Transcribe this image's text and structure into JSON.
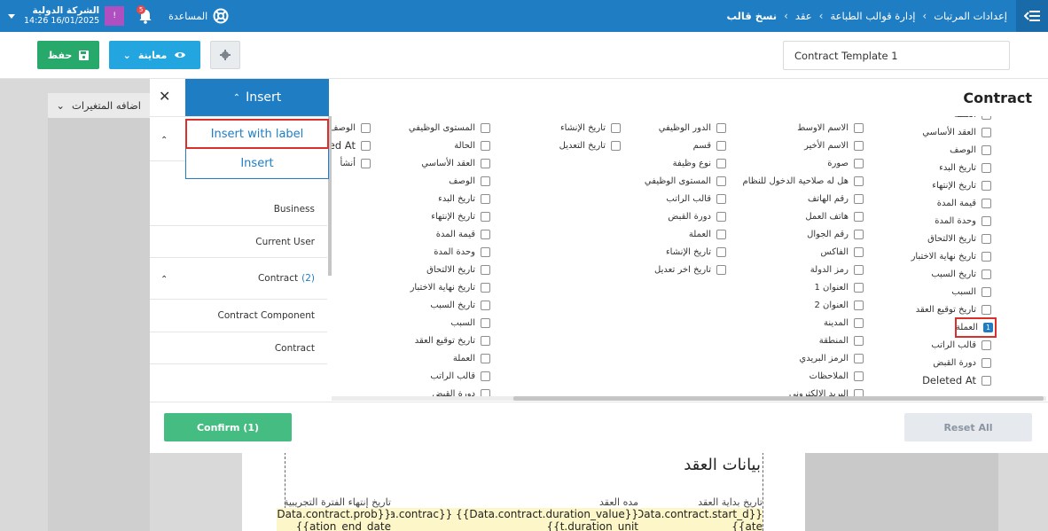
{
  "topbar": {
    "breadcrumbs": [
      "إعدادات المرتبات",
      "إدارة قوالب الطباعة",
      "عقد",
      "نسخ قالب"
    ],
    "help_label": "المساعدة",
    "notification_count": "5",
    "company_name": "الشركة الدولية",
    "datetime": "14:26 16/01/2025",
    "avatar_text": "!"
  },
  "toolbar": {
    "save_label": "حفظ",
    "preview_label": "معاينة",
    "template_name": "Contract Template 1"
  },
  "background": {
    "variables_label": "اضافه المتغيرات",
    "doc_heading": "بيانات العقد",
    "columns": [
      {
        "label": "تاريخ بداية العقد",
        "value": "Data.contract.start_d}}",
        "value2": "{{ate"
      },
      {
        "label": "مده العقد",
        "value": "Data.contrac}} {{Data.contract.duration_value}}",
        "value2": "{{t.duration_unit"
      },
      {
        "label": "تاريخ إنتهاء الفترة التجريبية",
        "value": "Data.contract.prob}}",
        "value2": "{{ation_end_date"
      }
    ]
  },
  "modal": {
    "title": "Contract",
    "insert_tab_label": "Insert",
    "dropdown": {
      "insert_with_label": "Insert with label",
      "insert": "Insert"
    },
    "left_list": {
      "business": "Business",
      "current_user": "Current User",
      "contract": "Contract",
      "contract_count": "(2)",
      "contract_component": "Contract Component",
      "contract_item": "Contract"
    },
    "col1": [
      "العملة",
      "العقد الأساسي",
      "الوصف",
      "تاريخ البدء",
      "تاريخ الإنتهاء",
      "قيمة المدة",
      "وحدة المدة",
      "تاريخ الالتحاق",
      "تاريخ نهاية الاختبار",
      "تاريخ السبب",
      "السبب",
      "تاريخ توقيع العقد",
      "العملة",
      "قالب الراتب",
      "دورة القبض",
      "Deleted At"
    ],
    "col2": [
      "الاسم الاوسط",
      "الاسم الأخير",
      "صورة",
      "هل له صلاحية الدخول للنظام",
      "رقم الهاتف",
      "هاتف العمل",
      "رقم الجوال",
      "الفاكس",
      "رمز الدولة",
      "العنوان 1",
      "العنوان 2",
      "المدينة",
      "المنطقة",
      "الرمز البريدي",
      "الملاحظات",
      "البريد الإلكتروني"
    ],
    "col3": [
      "الدور الوظيفي",
      "قسم",
      "نوع وظيفة",
      "المستوى الوظيفي",
      "قالب الراتب",
      "دورة القبض",
      "العملة",
      "تاريخ الإنشاء",
      "تاريخ اخر تعديل"
    ],
    "col4": [
      "تاريخ الإنشاء",
      "تاريخ التعديل"
    ],
    "col5": [
      "المستوى الوظيفي",
      "الحالة",
      "العقد الأساسي",
      "الوصف",
      "تاريخ البدء",
      "تاريخ الإنتهاء",
      "قيمة المدة",
      "وحدة المدة",
      "تاريخ الالتحاق",
      "تاريخ نهاية الاختبار",
      "تاريخ السبب",
      "السبب",
      "تاريخ توقيع العقد",
      "العملة",
      "قالب الراتب",
      "دورة القبض"
    ],
    "col6": [
      "الوصف",
      "ed At",
      "أنشأ"
    ],
    "checked_badge": "1",
    "confirm_label": "Confirm (1)",
    "reset_label": "Reset All"
  }
}
